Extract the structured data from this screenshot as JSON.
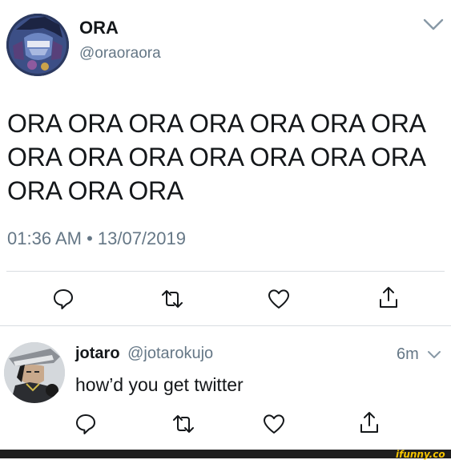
{
  "tweet": {
    "display_name": "ORA",
    "handle": "@oraoraora",
    "text": "ORA ORA ORA ORA ORA ORA ORA ORA ORA ORA ORA ORA ORA ORA ORA ORA ORA",
    "timestamp": "01:36 AM • 13/07/2019",
    "avatar_icon": "star-platinum-avatar-icon",
    "menu_icon": "chevron-down-icon"
  },
  "actions": {
    "reply_icon": "reply-icon",
    "retweet_icon": "retweet-icon",
    "like_icon": "heart-icon",
    "share_icon": "share-icon"
  },
  "reply": {
    "display_name": "jotaro",
    "handle": "@jotarokujo",
    "time": "6m",
    "text": "how’d you get twitter",
    "avatar_icon": "jotaro-avatar-icon"
  },
  "watermark": "ifunny.co",
  "colors": {
    "text_primary": "#14171a",
    "text_secondary": "#657786",
    "divider": "#d9dde1",
    "watermark": "#f5c400"
  }
}
